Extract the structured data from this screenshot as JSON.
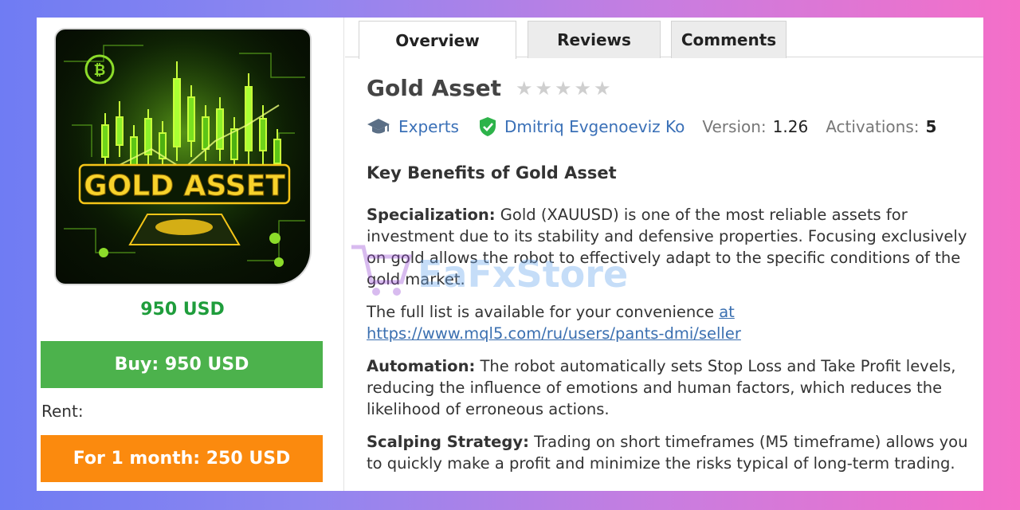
{
  "product": {
    "image_text": "GOLD ASSET",
    "price": "950 USD",
    "buy_label": "Buy: 950 USD",
    "rent_label": "Rent:",
    "rent_option": "For 1 month: 250 USD"
  },
  "tabs": [
    {
      "label": "Overview",
      "active": true
    },
    {
      "label": "Reviews",
      "active": false
    },
    {
      "label": "Comments",
      "active": false
    }
  ],
  "title": "Gold Asset",
  "rating": {
    "stars_filled": 0,
    "stars_total": 5
  },
  "meta": {
    "category": "Experts",
    "author": "Dmitriq Evgenoeviz Ko",
    "version_label": "Version:",
    "version": "1.26",
    "activations_label": "Activations:",
    "activations": "5"
  },
  "description": {
    "heading": "Key Benefits of Gold Asset",
    "p1_label": "Specialization:",
    "p1_text": " Gold (XAUUSD) is one of the most reliable assets for investment due to its stability and defensive properties. Focusing exclusively on gold allows the robot to effectively adapt to the specific conditions of the gold market.",
    "p2_text": "The full list is available for your convenience ",
    "p2_link": "at https://www.mql5.com/ru/users/pants-dmi/seller",
    "p3_label": "Automation:",
    "p3_text": " The robot automatically sets Stop Loss and Take Profit levels, reducing the influence of emotions and human factors, which reduces the likelihood of erroneous actions.",
    "p4_label": "Scalping Strategy:",
    "p4_text": " Trading on short timeframes (M5 timeframe) allows you to quickly make a profit and minimize the risks typical of long-term trading."
  },
  "watermark": "EaFxStore",
  "colors": {
    "price_green": "#1f9d3c",
    "buy_green": "#4cb24c",
    "rent_orange": "#fb8a0e",
    "link_blue": "#3a70b7",
    "verified_green": "#2db34a"
  }
}
